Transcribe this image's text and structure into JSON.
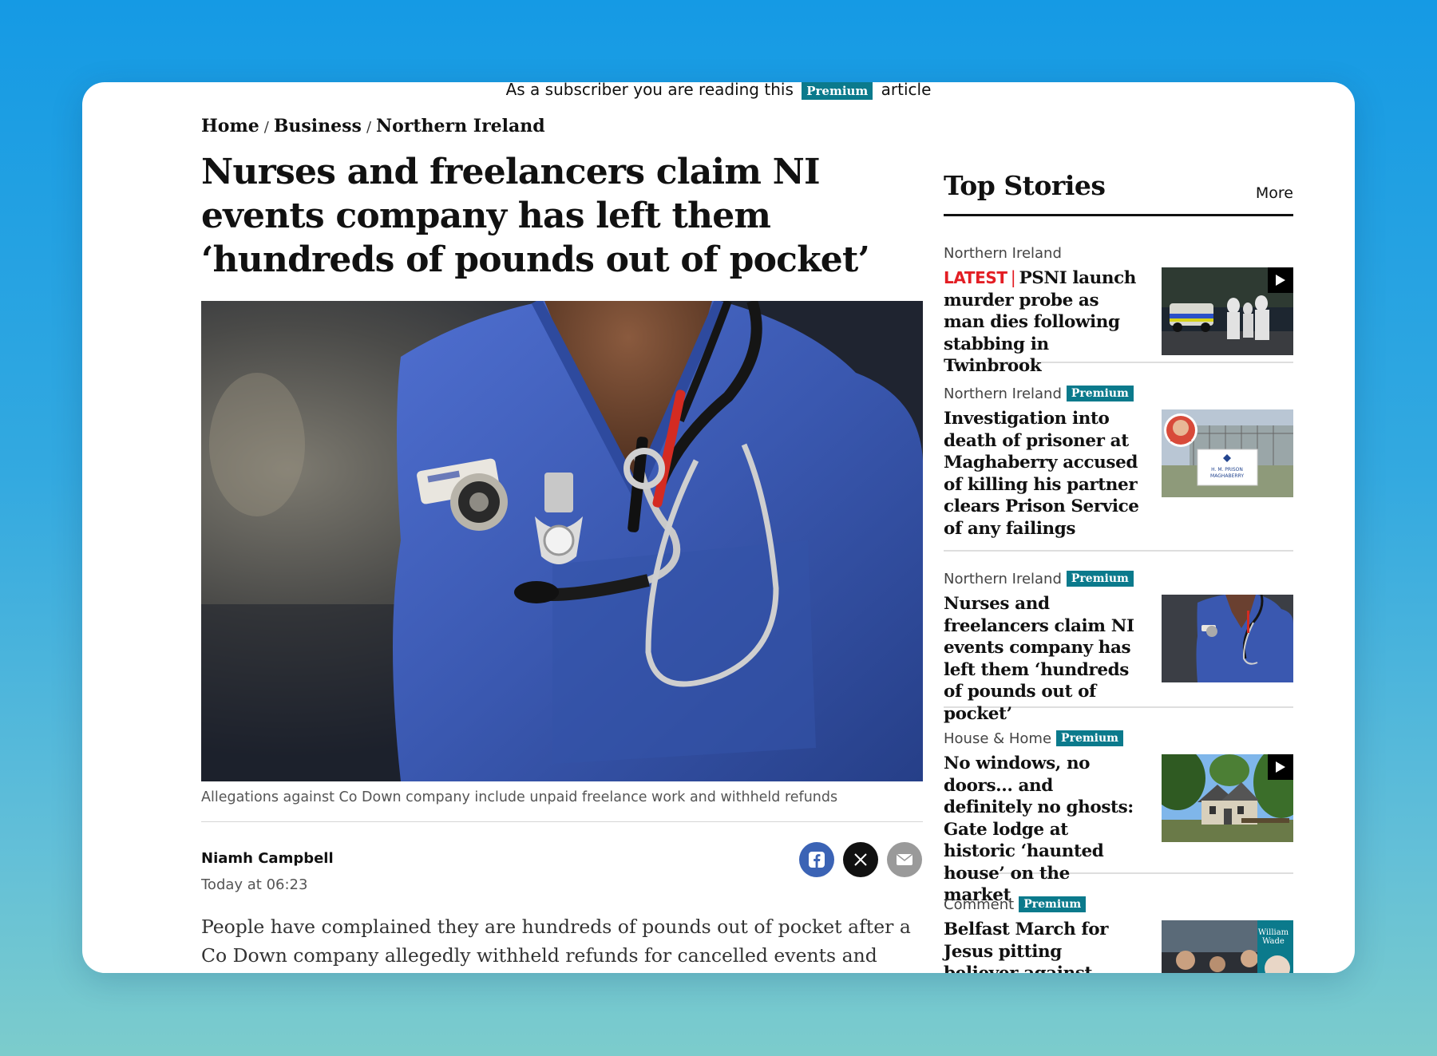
{
  "banner": {
    "text_before": "As a subscriber you are reading this",
    "badge": "Premium",
    "text_after": "article"
  },
  "breadcrumb": [
    "Home",
    "Business",
    "Northern Ireland"
  ],
  "article": {
    "headline": "Nurses and freelancers claim NI events company has left them ‘hundreds of pounds out of pocket’",
    "caption": "Allegations against Co Down company include unpaid freelance work and withheld refunds",
    "author": "Niamh Campbell",
    "date": "Today at 06:23",
    "lede": "People have complained they are hundreds of pounds out of pocket after a Co Down company allegedly withheld refunds for cancelled events and failed to pay multiple"
  },
  "share": {
    "facebook_icon": "facebook-icon",
    "x_icon": "x-icon",
    "mail_icon": "mail-icon"
  },
  "top_stories": {
    "title": "Top Stories",
    "more": "More",
    "items": [
      {
        "category": "Northern Ireland",
        "premium": false,
        "latest": "LATEST",
        "headline": "PSNI launch murder probe as man dies following stabbing in Twinbrook",
        "video": true
      },
      {
        "category": "Northern Ireland",
        "premium": true,
        "badge": "Premium",
        "headline": "Investigation into death of prisoner at Maghaberry accused of killing his partner clears Prison Service of any failings",
        "video": false,
        "sign_text": "H. M. PRISON\nMAGHABERRY"
      },
      {
        "category": "Northern Ireland",
        "premium": true,
        "badge": "Premium",
        "headline": "Nurses and freelancers claim NI events company has left them ‘hundreds of pounds out of pocket’",
        "video": false
      },
      {
        "category": "House & Home",
        "premium": true,
        "badge": "Premium",
        "headline": "No windows, no doors... and definitely no ghosts: Gate lodge at historic ‘haunted house’ on the market",
        "video": true
      },
      {
        "category": "Comment",
        "premium": true,
        "badge": "Premium",
        "headline": "Belfast March for Jesus pitting believer against believer before it’s even",
        "video": false,
        "author_tag": "William Wade"
      }
    ]
  },
  "colors": {
    "premium_badge": "#0b7a8c",
    "latest_red": "#e31e24",
    "scrubs_blue": "#3f5fb8"
  }
}
